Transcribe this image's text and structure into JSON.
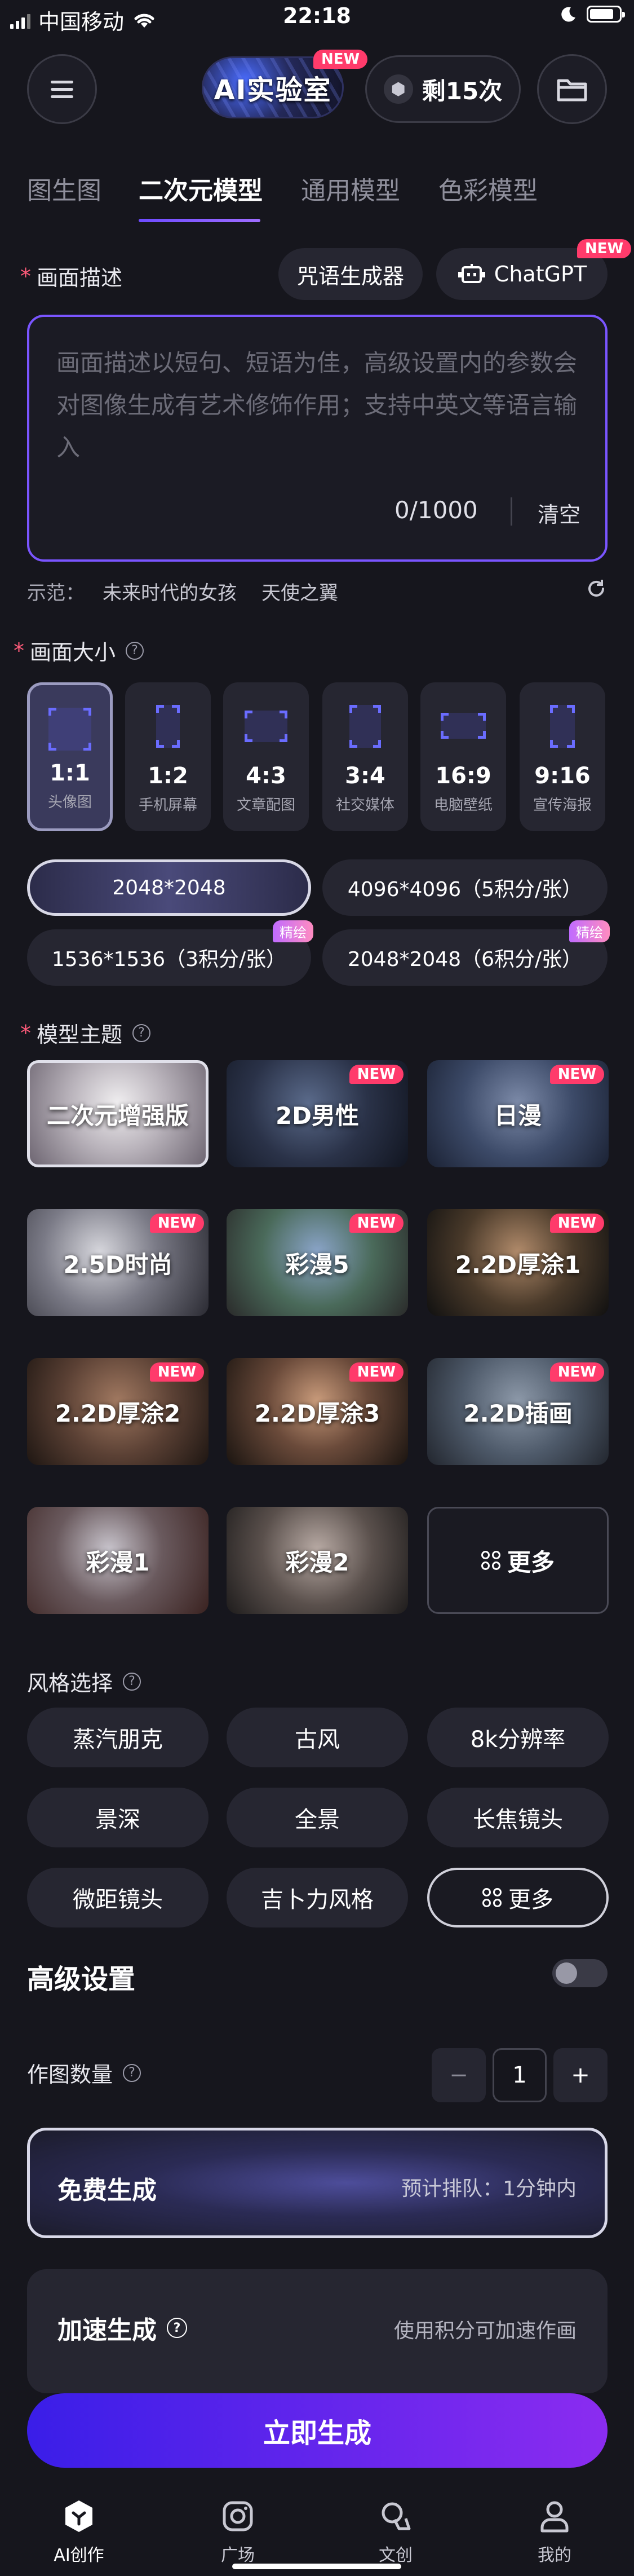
{
  "status_bar": {
    "carrier": "中国移动",
    "time": "22:18",
    "battery_level": 0.82
  },
  "header": {
    "logo_text": "AI实验室",
    "logo_badge": "NEW",
    "credits": "剩15次"
  },
  "tabs": [
    {
      "label": "图生图",
      "active": false
    },
    {
      "label": "二次元模型",
      "active": true
    },
    {
      "label": "通用模型",
      "active": false
    },
    {
      "label": "色彩模型",
      "active": false
    }
  ],
  "prompt": {
    "label": "画面描述",
    "spell_generator": "咒语生成器",
    "chatgpt_label": "ChatGPT",
    "chatgpt_badge": "NEW",
    "placeholder": "画面描述以短句、短语为佳，高级设置内的参数会对图像生成有艺术修饰作用；支持中英文等语言输入",
    "counter": "0/1000",
    "clear": "清空",
    "examples_label": "示范：",
    "examples": [
      "未来时代的女孩",
      "天使之翼"
    ]
  },
  "size": {
    "label": "画面大小",
    "options": [
      {
        "ratio": "1:1",
        "desc": "头像图",
        "active": true
      },
      {
        "ratio": "1:2",
        "desc": "手机屏幕",
        "active": false
      },
      {
        "ratio": "4:3",
        "desc": "文章配图",
        "active": false
      },
      {
        "ratio": "3:4",
        "desc": "社交媒体",
        "active": false
      },
      {
        "ratio": "16:9",
        "desc": "电脑壁纸",
        "active": false
      },
      {
        "ratio": "9:16",
        "desc": "宣传海报",
        "active": false
      }
    ],
    "resolutions": [
      {
        "label": "2048*2048",
        "active": true,
        "tag": ""
      },
      {
        "label": "4096*4096（5积分/张）",
        "active": false,
        "tag": ""
      },
      {
        "label": "1536*1536（3积分/张）",
        "active": false,
        "tag": "精绘"
      },
      {
        "label": "2048*2048（6积分/张）",
        "active": false,
        "tag": "精绘"
      }
    ]
  },
  "model": {
    "label": "模型主题",
    "items": [
      {
        "name": "二次元增强版",
        "badge": "",
        "active": true
      },
      {
        "name": "2D男性",
        "badge": "NEW",
        "active": false
      },
      {
        "name": "日漫",
        "badge": "NEW",
        "active": false
      },
      {
        "name": "2.5D时尚",
        "badge": "NEW",
        "active": false
      },
      {
        "name": "彩漫5",
        "badge": "NEW",
        "active": false
      },
      {
        "name": "2.2D厚涂1",
        "badge": "NEW",
        "active": false
      },
      {
        "name": "2.2D厚涂2",
        "badge": "NEW",
        "active": false
      },
      {
        "name": "2.2D厚涂3",
        "badge": "NEW",
        "active": false
      },
      {
        "name": "2.2D插画",
        "badge": "NEW",
        "active": false
      },
      {
        "name": "彩漫1",
        "badge": "",
        "active": false
      },
      {
        "name": "彩漫2",
        "badge": "",
        "active": false
      }
    ],
    "more": "更多"
  },
  "style": {
    "label": "风格选择",
    "items": [
      "蒸汽朋克",
      "古风",
      "8k分辨率",
      "景深",
      "全景",
      "长焦镜头",
      "微距镜头",
      "吉卜力风格"
    ],
    "more": "更多"
  },
  "advanced": {
    "label": "高级设置",
    "enabled": false
  },
  "count": {
    "label": "作图数量",
    "value": "1",
    "minus": "−",
    "plus": "+"
  },
  "free_generate": {
    "label": "免费生成",
    "queue": "预计排队：1分钟内"
  },
  "accelerate": {
    "label": "加速生成",
    "hint": "使用积分可加速作画"
  },
  "generate_button": "立即生成",
  "tabbar": [
    {
      "label": "AI创作",
      "icon": "cube-icon",
      "active": true
    },
    {
      "label": "广场",
      "icon": "camera-icon",
      "active": false
    },
    {
      "label": "文创",
      "icon": "bag-icon",
      "active": false
    },
    {
      "label": "我的",
      "icon": "user-icon",
      "active": false
    }
  ]
}
